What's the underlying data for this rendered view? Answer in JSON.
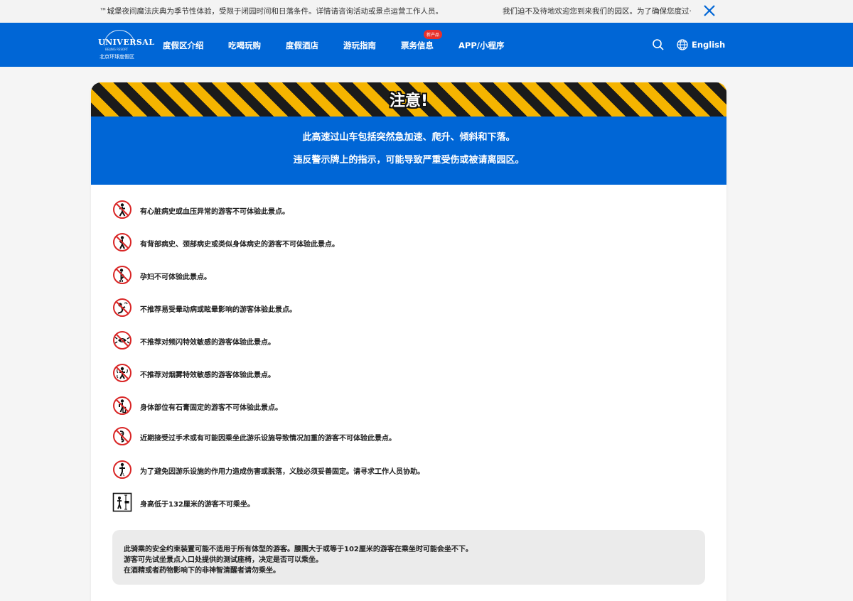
{
  "topbar": {
    "left_text": "™城堡夜间魔法庆典为季节性体验，受限于闭园时间和日落条件。详情请咨询活动或景点运营工作人员。",
    "right_text": "我们迫不及待地欢迎您到来我们的园区。为了确保您度过·"
  },
  "logo": {
    "main": "UNIVERSAL",
    "sub": "BEIJING RESORT",
    "cn": "北京环球度假区"
  },
  "nav": {
    "items": [
      "度假区介绍",
      "吃喝玩购",
      "度假酒店",
      "游玩指南",
      "票务信息",
      "APP/小程序"
    ],
    "badge": "新产品",
    "language": "English"
  },
  "warning": {
    "title": "注意!",
    "line1": "此高速过山车包括突然急加速、爬升、倾斜和下落。",
    "line2": "违反警示牌上的指示，可能导致严重受伤或被请离园区。"
  },
  "rules": [
    {
      "icon": "heart-condition-icon",
      "text": "有心脏病史或血压异常的游客不可体验此景点。"
    },
    {
      "icon": "back-neck-condition-icon",
      "text": "有背部病史、颈部病史或类似身体病史的游客不可体验此景点。"
    },
    {
      "icon": "pregnant-icon",
      "text": "孕妇不可体验此景点。"
    },
    {
      "icon": "motion-sickness-icon",
      "text": "不推荐易受晕动病或眩晕影响的游客体验此景点。"
    },
    {
      "icon": "strobe-light-icon",
      "text": "不推荐对频闪特效敏感的游客体验此景点。"
    },
    {
      "icon": "smoke-effect-icon",
      "text": "不推荐对烟雾特效敏感的游客体验此景点。"
    },
    {
      "icon": "cast-icon",
      "text": "身体部位有石膏固定的游客不可体验此景点。"
    },
    {
      "icon": "surgery-icon",
      "text": "近期接受过手术或有可能因乘坐此游乐设施导致情况加重的游客不可体验此景点。"
    },
    {
      "icon": "prosthetic-icon",
      "text": "为了避免因游乐设施的作用力造成伤害或脱落，义肢必须妥善固定。请寻求工作人员协助。"
    },
    {
      "icon": "height-requirement-icon",
      "text": "身高低于132厘米的游客不可乘坐。"
    }
  ],
  "note": {
    "line1": "此骑乘的安全约束装置可能不适用于所有体型的游客。腰围大于或等于102厘米的游客在乘坐时可能会坐不下。",
    "line2": "游客可先试坐景点入口处提供的测试座椅，决定是否可以乘坐。",
    "line3": "在酒精或者药物影响下的非神智清醒者请勿乘坐。"
  },
  "colors": {
    "brand_blue": "#0066d6",
    "warning_red": "#d92626",
    "stripe_yellow": "#f5b400",
    "stripe_black": "#1b1b1b",
    "badge_red": "#e8302b"
  }
}
